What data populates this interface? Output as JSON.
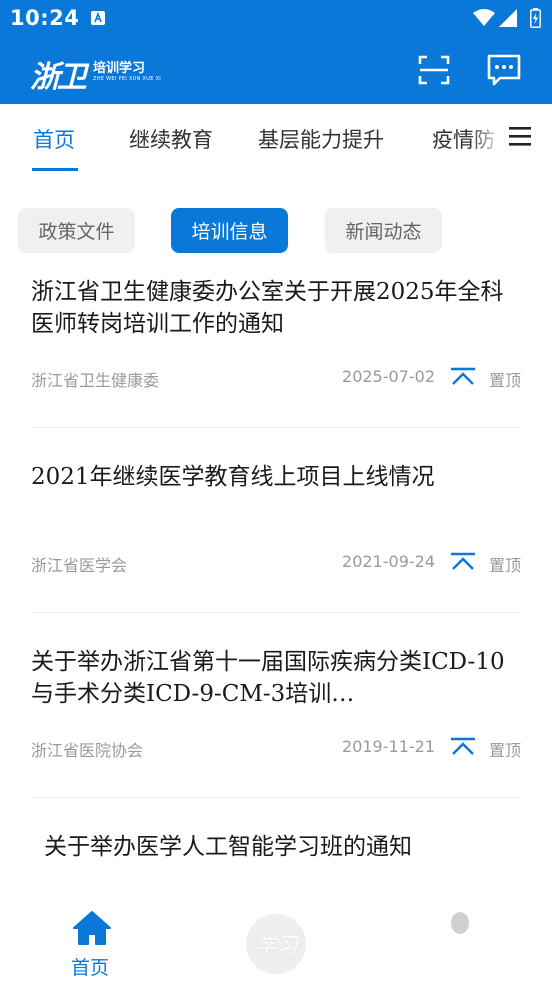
{
  "status_bar": {
    "time": "10:24",
    "icons": [
      "notification-icon",
      "wifi-icon",
      "signal-icon",
      "battery-icon"
    ]
  },
  "header": {
    "logo_main": "浙卫",
    "logo_sub": "培训学习",
    "logo_pinyin": "ZHE WEI PEI XUN XUE XI",
    "actions": [
      "scan-icon",
      "message-icon"
    ]
  },
  "tabs": [
    {
      "label": "首页",
      "active": true
    },
    {
      "label": "继续教育",
      "active": false
    },
    {
      "label": "基层能力提升",
      "active": false
    },
    {
      "label": "疫情防",
      "active": false
    }
  ],
  "chips": [
    {
      "label": "政策文件",
      "active": false
    },
    {
      "label": "培训信息",
      "active": true
    },
    {
      "label": "新闻动态",
      "active": false
    }
  ],
  "articles": [
    {
      "title": "浙江省卫生健康委办公室关于开展2025年全科医师转岗培训工作的通知",
      "source": "浙江省卫生健康委",
      "date": "2025-07-02",
      "pin_label": "置顶"
    },
    {
      "title": "2021年继续医学教育线上项目上线情况",
      "source": "浙江省医学会",
      "date": "2021-09-24",
      "pin_label": "置顶"
    },
    {
      "title": "关于举办浙江省第十一届国际疾病分类ICD-10与手术分类ICD-9-CM-3培训…",
      "source": "浙江省医院协会",
      "date": "2019-11-21",
      "pin_label": "置顶"
    },
    {
      "title": "关于举办医学人工智能学习班的通知"
    }
  ],
  "bottom_nav": {
    "home_label": "首页",
    "study_label": "学习"
  },
  "colors": {
    "brand": "#0a78d8",
    "chip_bg": "#f0f0f0",
    "muted_text": "#9a9a9a"
  }
}
